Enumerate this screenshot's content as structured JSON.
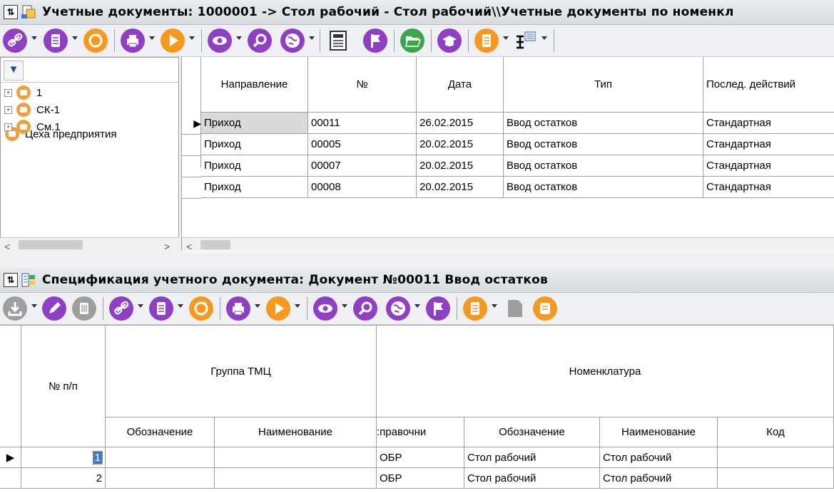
{
  "top_window": {
    "title": "Учетные документы: 1000001 -> Стол рабочий - Стол рабочий\\\\Учетные документы по номенкл"
  },
  "bottom_window": {
    "title": "Спецификация учетного документа: Документ №00011 Ввод остатков"
  },
  "tree": {
    "root": "Цеха предприятия",
    "items": [
      "1",
      "СК-1",
      "См.1"
    ]
  },
  "doc_table": {
    "columns": [
      "Направление",
      "№",
      "Дата",
      "Тип",
      "Послед. действий"
    ],
    "rows": [
      {
        "direction": "Приход",
        "num": "00011",
        "date": "26.02.2015",
        "type": "Ввод остатков",
        "last": "Стандартная"
      },
      {
        "direction": "Приход",
        "num": "00005",
        "date": "20.02.2015",
        "type": "Ввод остатков",
        "last": "Стандартная"
      },
      {
        "direction": "Приход",
        "num": "00007",
        "date": "20.02.2015",
        "type": "Ввод остатков",
        "last": "Стандартная"
      },
      {
        "direction": "Приход",
        "num": "00008",
        "date": "20.02.2015",
        "type": "Ввод остатков",
        "last": "Стандартная"
      }
    ]
  },
  "spec_table": {
    "col_num": "№ п/п",
    "group_header": "Группа ТМЦ",
    "nomen_header": "Номенклатура",
    "sub_columns": [
      "Обозначение",
      "Наименование",
      ":правочни",
      "Обозначение",
      "Наименование",
      "Код"
    ],
    "rows": [
      {
        "n": "1",
        "g_code": "",
        "g_name": "",
        "ref": "ОБР",
        "code": "Стол рабочий",
        "name": "Стол рабочий",
        "kod": ""
      },
      {
        "n": "2",
        "g_code": "",
        "g_name": "",
        "ref": "ОБР",
        "code": "Стол рабочий",
        "name": "Стол рабочий",
        "kod": ""
      }
    ]
  },
  "icons": {
    "top_toolbar": [
      "link-icon",
      "document-icon",
      "refresh-icon",
      "printer-icon",
      "play-icon",
      "eye-icon",
      "search-icon",
      "globe-icon",
      "calculator-icon",
      "flag-icon",
      "folder-open-icon",
      "graduation-icon",
      "list-icon",
      "tree-structure-icon"
    ],
    "bottom_toolbar": [
      "download-icon",
      "edit-icon",
      "delete-icon",
      "link-icon",
      "document-icon",
      "refresh-icon",
      "printer-icon",
      "play-icon",
      "eye-icon",
      "search-icon",
      "globe-icon",
      "flag-icon",
      "list-icon",
      "page-icon",
      "scroll-icon"
    ]
  },
  "colors": {
    "icon_purple": "#8e3fc4",
    "icon_orange": "#f59a1e",
    "icon_grey": "#9e9e9e",
    "icon_green": "#3aa84a",
    "selection": "#d9d9d9"
  }
}
